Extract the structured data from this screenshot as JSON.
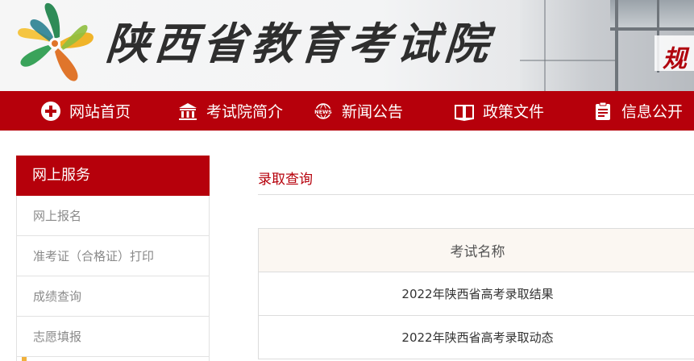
{
  "header": {
    "site_title": "陕西省教育考试院",
    "slogan": "规"
  },
  "nav": {
    "items": [
      {
        "label": "网站首页",
        "icon": "home-plus-icon"
      },
      {
        "label": "考试院简介",
        "icon": "building-icon"
      },
      {
        "label": "新闻公告",
        "icon": "news-icon"
      },
      {
        "label": "政策文件",
        "icon": "book-icon"
      },
      {
        "label": "信息公开",
        "icon": "document-list-icon"
      }
    ]
  },
  "sidebar": {
    "title": "网上服务",
    "items": [
      {
        "label": "网上报名"
      },
      {
        "label": "准考证（合格证）打印"
      },
      {
        "label": "成绩查询"
      },
      {
        "label": "志愿填报"
      }
    ]
  },
  "main": {
    "breadcrumb": "录取查询",
    "table": {
      "header": "考试名称",
      "rows": [
        {
          "name": "2022年陕西省高考录取结果"
        },
        {
          "name": "2022年陕西省高考录取动态"
        }
      ]
    }
  },
  "colors": {
    "brand_red": "#b6000b",
    "accent_orange": "#f1b13c",
    "table_header_bg": "#fbf7f2"
  }
}
